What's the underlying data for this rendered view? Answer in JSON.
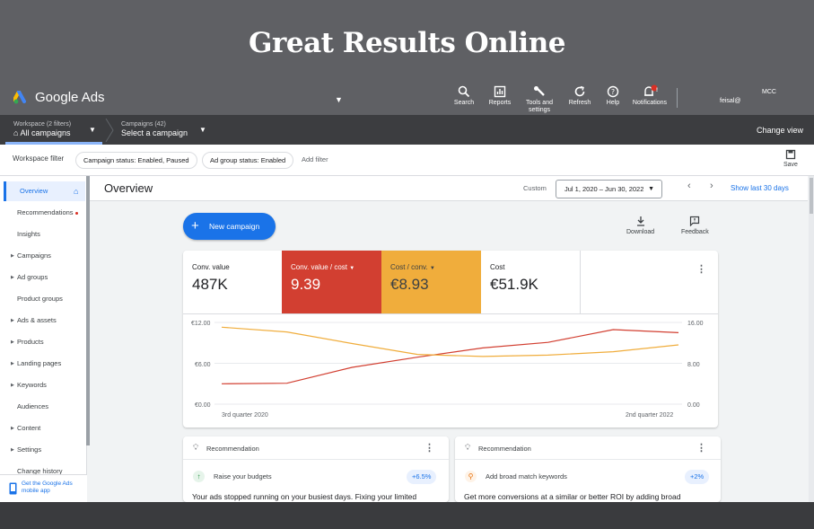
{
  "banner": {
    "title": "Great Results Online"
  },
  "header": {
    "app_name": "Google Ads",
    "tools": [
      {
        "label": "Search"
      },
      {
        "label": "Reports"
      },
      {
        "label": "Tools and settings"
      },
      {
        "label": "Refresh"
      },
      {
        "label": "Help"
      },
      {
        "label": "Notifications",
        "badge": "!"
      }
    ],
    "mcc": "MCC",
    "user": "feisal@"
  },
  "workspace": {
    "filters_label": "Workspace (2 filters)",
    "all_campaigns": "All campaigns",
    "campaigns_label": "Campaigns (42)",
    "select_campaign": "Select a campaign",
    "change_view": "Change view"
  },
  "filterbar": {
    "label": "Workspace filter",
    "chips": [
      "Campaign status: Enabled, Paused",
      "Ad group status: Enabled"
    ],
    "add_filter": "Add filter",
    "save": "Save"
  },
  "sidebar": {
    "items": [
      {
        "label": "Overview",
        "active": true
      },
      {
        "label": "Recommendations",
        "dot": true
      },
      {
        "label": "Insights"
      },
      {
        "label": "Campaigns",
        "expand": true
      },
      {
        "label": "Ad groups",
        "expand": true
      },
      {
        "label": "Product groups"
      },
      {
        "label": "Ads & assets",
        "expand": true
      },
      {
        "label": "Products",
        "expand": true
      },
      {
        "label": "Landing pages",
        "expand": true
      },
      {
        "label": "Keywords",
        "expand": true
      },
      {
        "label": "Audiences"
      },
      {
        "label": "Content",
        "expand": true
      },
      {
        "label": "Settings",
        "expand": true
      },
      {
        "label": "Change history"
      }
    ],
    "mobile_app": "Get the Google Ads mobile app"
  },
  "overview": {
    "title": "Overview",
    "custom_label": "Custom",
    "date_range": "Jul 1, 2020 – Jun 30, 2022",
    "show_last": "Show last 30 days",
    "new_campaign": "New campaign",
    "download": "Download",
    "feedback": "Feedback"
  },
  "metrics": [
    {
      "label": "Conv. value",
      "value": "487K"
    },
    {
      "label": "Conv. value / cost",
      "value": "9.39",
      "color": "#d23f31"
    },
    {
      "label": "Cost / conv.",
      "value": "€8.93",
      "color": "#f0ad3c"
    },
    {
      "label": "Cost",
      "value": "€51.9K"
    }
  ],
  "chart_data": {
    "type": "line",
    "x_labels": [
      "3rd quarter 2020",
      "2nd quarter 2022"
    ],
    "y_left_ticks": [
      "€12.00",
      "€6.00",
      "€0.00"
    ],
    "y_left_range": [
      0,
      12
    ],
    "y_right_ticks": [
      "16.00",
      "8.00",
      "0.00"
    ],
    "y_right_range": [
      0,
      16
    ],
    "grid": true,
    "series": [
      {
        "axis": "right",
        "color": "#d23f31",
        "values": [
          4.0,
          4.1,
          7.2,
          9.2,
          11.0,
          12.1,
          14.6,
          14.0
        ]
      },
      {
        "axis": "left",
        "color": "#f0ad3c",
        "values": [
          11.3,
          10.6,
          8.9,
          7.3,
          7.0,
          7.2,
          7.7,
          8.7
        ]
      }
    ]
  },
  "recommendations": [
    {
      "title": "Recommendation",
      "action": "Raise your budgets",
      "badge": "+6.5%",
      "desc": "Your ads stopped running on your busiest days. Fixing your limited",
      "icon_color": "#1e8e3e",
      "icon": "↑"
    },
    {
      "title": "Recommendation",
      "action": "Add broad match keywords",
      "badge": "+2%",
      "desc": "Get more conversions at a similar or better ROI by adding broad",
      "icon_color": "#e8710a",
      "icon": "⚲"
    }
  ]
}
